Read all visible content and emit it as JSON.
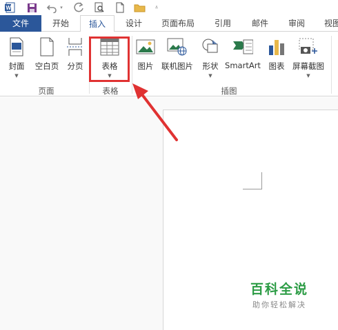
{
  "qat": {
    "icons": [
      "word-logo-icon",
      "save-icon",
      "undo-icon",
      "redo-icon",
      "print-preview-icon",
      "new-document-icon",
      "open-folder-icon",
      "customize-qat-icon"
    ]
  },
  "tabs": [
    {
      "label": "文件",
      "state": "file"
    },
    {
      "label": "开始",
      "state": "normal"
    },
    {
      "label": "插入",
      "state": "active"
    },
    {
      "label": "设计",
      "state": "normal"
    },
    {
      "label": "页面布局",
      "state": "normal"
    },
    {
      "label": "引用",
      "state": "normal"
    },
    {
      "label": "邮件",
      "state": "normal"
    },
    {
      "label": "审阅",
      "state": "normal"
    },
    {
      "label": "视图",
      "state": "normal"
    }
  ],
  "ribbon": {
    "pages_group": {
      "label": "页面",
      "cover_page": "封面",
      "blank_page": "空白页",
      "page_break": "分页"
    },
    "tables_group": {
      "label": "表格",
      "table": "表格"
    },
    "illustrations_group": {
      "label": "插图",
      "pictures": "图片",
      "online_pictures": "联机图片",
      "shapes": "形状",
      "smartart": "SmartArt",
      "chart": "图表",
      "screenshot": "屏幕截图"
    }
  },
  "watermark": {
    "title": "百科全说",
    "subtitle": "助你轻松解决"
  },
  "colors": {
    "accent": "#2b579a",
    "highlight": "#e03232",
    "watermark": "#2c9c45"
  }
}
